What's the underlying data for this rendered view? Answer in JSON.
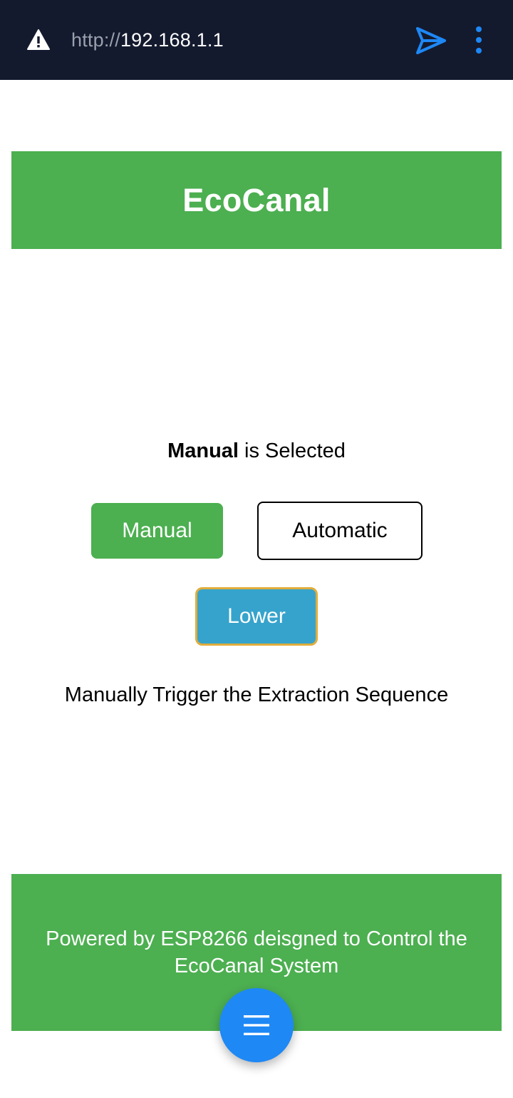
{
  "browser": {
    "url_scheme": "http://",
    "url_host": "192.168.1.1",
    "security_icon": "warning-icon",
    "send_icon": "send-icon",
    "menu_icon": "more-vertical-icon"
  },
  "header": {
    "title": "EcoCanal"
  },
  "mode": {
    "selected": "Manual",
    "selected_suffix": " is Selected"
  },
  "buttons": {
    "manual": "Manual",
    "automatic": "Automatic",
    "lower": "Lower"
  },
  "description": "Manually Trigger the Extraction Sequence",
  "footer": {
    "text": "Powered by ESP8266 deisgned to Control the EcoCanal System"
  },
  "fab": {
    "icon": "hamburger-menu-icon"
  },
  "colors": {
    "accent_green": "#4caf50",
    "lower_button": "#36a3cc",
    "lower_border": "#e0ad3b",
    "fab_blue": "#1e88f5",
    "topbar": "#141a2e"
  }
}
